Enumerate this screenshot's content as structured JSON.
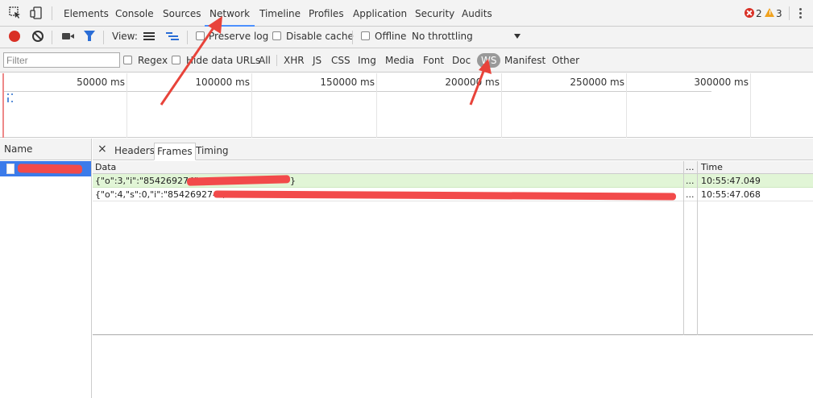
{
  "tabs": {
    "items": [
      "Elements",
      "Console",
      "Sources",
      "Network",
      "Timeline",
      "Profiles",
      "Application",
      "Security",
      "Audits"
    ],
    "active": "Network"
  },
  "status": {
    "errors": "2",
    "warnings": "3"
  },
  "toolbar": {
    "view_label": "View:",
    "preserve_log": "Preserve log",
    "disable_cache": "Disable cache",
    "offline": "Offline",
    "throttling": "No throttling"
  },
  "filterbar": {
    "placeholder": "Filter",
    "regex": "Regex",
    "hide_data_urls": "Hide data URLs",
    "types": [
      "All",
      "XHR",
      "JS",
      "CSS",
      "Img",
      "Media",
      "Font",
      "Doc",
      "WS",
      "Manifest",
      "Other"
    ],
    "active_type": "WS"
  },
  "overview": {
    "ticks": [
      "50000 ms",
      "100000 ms",
      "150000 ms",
      "200000 ms",
      "250000 ms",
      "300000 ms"
    ]
  },
  "requests": {
    "header": "Name"
  },
  "detail": {
    "close": "×",
    "tabs": [
      "Headers",
      "Frames",
      "Timing"
    ],
    "active_tab": "Frames",
    "columns": {
      "data": "Data",
      "ellipsis": "...",
      "time": "Time"
    },
    "frames": [
      {
        "data": "{\"o\":3,\"i\":\"854269274\",",
        "tail": "}",
        "ellipsis": "...",
        "time": "10:55:47.049",
        "direction": "sent"
      },
      {
        "data": "{\"o\":4,\"s\":0,\"i\":\"854269274\",",
        "tail": "",
        "ellipsis": "...",
        "time": "10:55:47.068",
        "direction": "received"
      }
    ]
  },
  "colors": {
    "accent": "#4d90fe",
    "selection": "#3b7bea",
    "redaction": "#f24a4a",
    "sent_frame": "#e1f5d6"
  }
}
